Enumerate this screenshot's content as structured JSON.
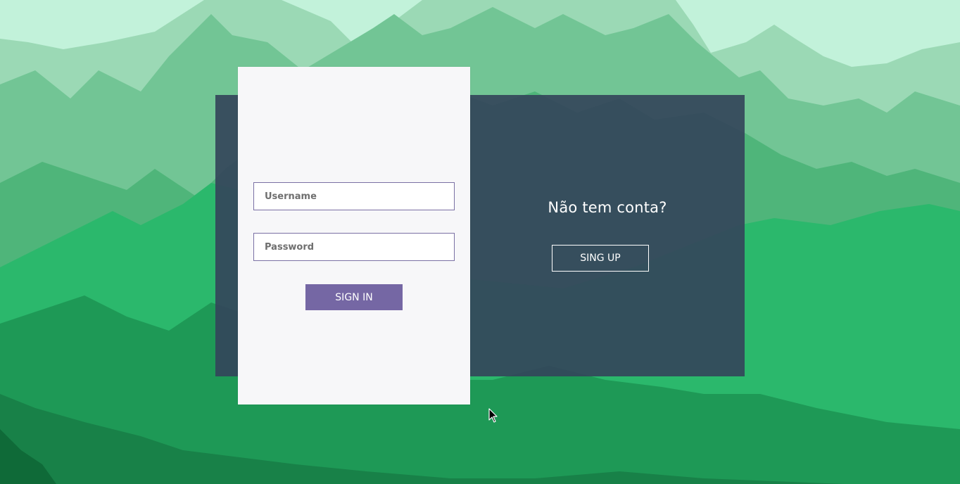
{
  "login": {
    "username_placeholder": "Username",
    "password_placeholder": "Password",
    "signin_label": "SIGN IN"
  },
  "signup": {
    "heading": "Não tem conta?",
    "button_label": "SING UP"
  },
  "colors": {
    "sky": "#c2f2da",
    "panel": "#34445a",
    "card": "#f7f7f9",
    "accent": "#7567a4",
    "field_border": "#7a70a4"
  },
  "icons": {
    "pointer": "mouse-pointer-icon"
  }
}
